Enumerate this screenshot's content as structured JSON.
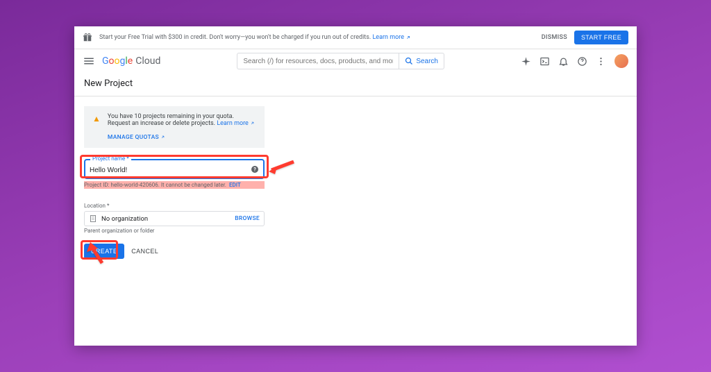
{
  "promo": {
    "text": "Start your Free Trial with $300 in credit. Don't worry—you won't be charged if you run out of credits. ",
    "learn_more": "Learn more",
    "dismiss": "DISMISS",
    "start_free": "START FREE"
  },
  "logo": {
    "name": "Google",
    "product": "Cloud"
  },
  "search": {
    "placeholder": "Search (/) for resources, docs, products, and more",
    "button": "Search"
  },
  "page": {
    "title": "New Project"
  },
  "quota": {
    "text": "You have 10 projects remaining in your quota. Request an increase or delete projects. ",
    "learn_more": "Learn more",
    "manage": "MANAGE QUOTAS"
  },
  "project_name": {
    "label": "Project name",
    "value": "Hello World!",
    "id_text": "Project ID: hello-world-420606. It cannot be changed later.",
    "edit": "EDIT"
  },
  "location": {
    "label": "Location",
    "value": "No organization",
    "browse": "BROWSE",
    "hint": "Parent organization or folder"
  },
  "actions": {
    "create": "CREATE",
    "cancel": "CANCEL"
  }
}
